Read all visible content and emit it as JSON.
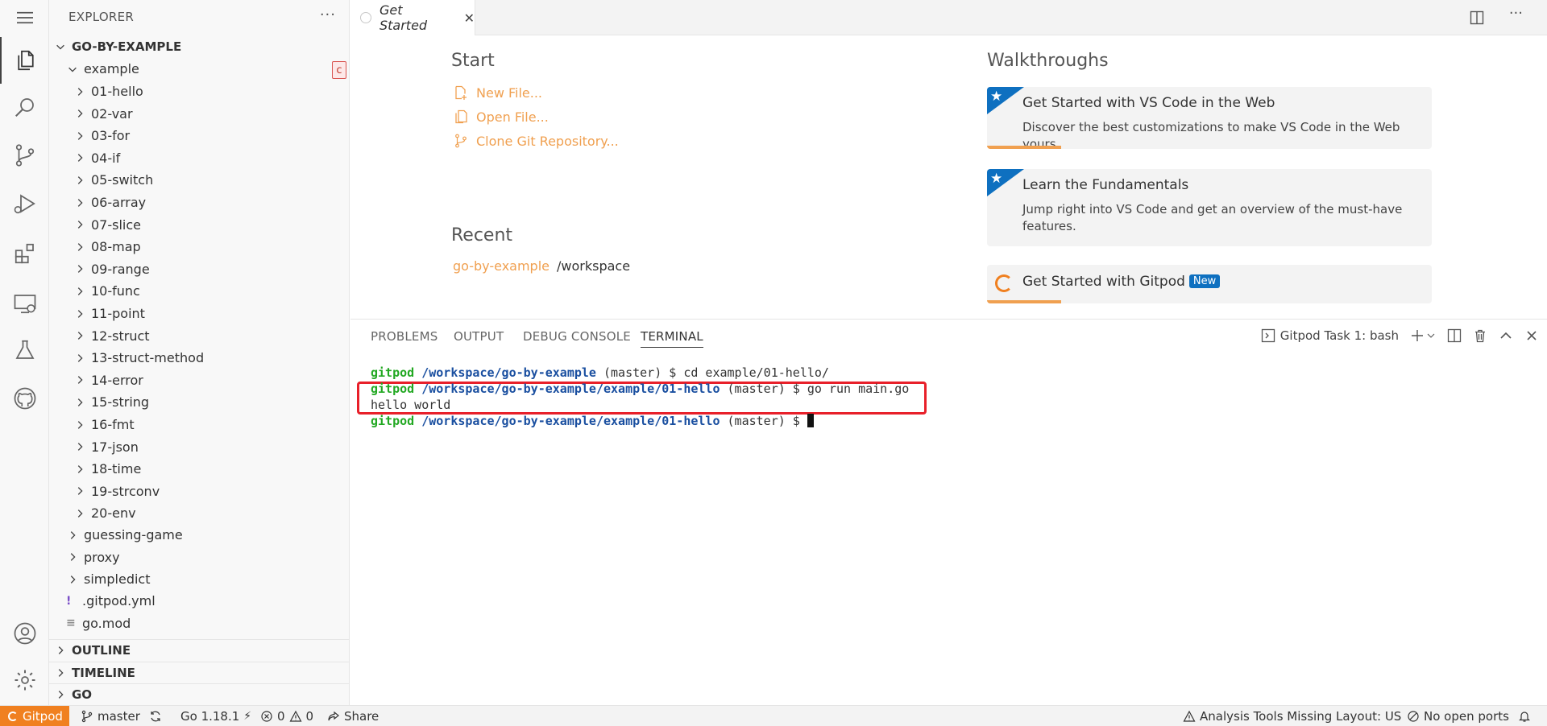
{
  "explorer": {
    "title": "EXPLORER",
    "more": "···",
    "root": "GO-BY-EXAMPLE",
    "folder": "example",
    "badge": "c",
    "subfolders": [
      "01-hello",
      "02-var",
      "03-for",
      "04-if",
      "05-switch",
      "06-array",
      "07-slice",
      "08-map",
      "09-range",
      "10-func",
      "11-point",
      "12-struct",
      "13-struct-method",
      "14-error",
      "15-string",
      "16-fmt",
      "17-json",
      "18-time",
      "19-strconv",
      "20-env"
    ],
    "top_items": [
      "guessing-game",
      "proxy",
      "simpledict"
    ],
    "files": [
      {
        "icon": "!",
        "name": ".gitpod.yml"
      },
      {
        "icon": "≡",
        "name": "go.mod"
      }
    ],
    "sections": [
      "OUTLINE",
      "TIMELINE",
      "GO"
    ]
  },
  "editor": {
    "tab_label": "Get Started",
    "tab_close": "✕"
  },
  "welcome": {
    "start_heading": "Start",
    "start_links": [
      "New File...",
      "Open File...",
      "Clone Git Repository..."
    ],
    "recent_heading": "Recent",
    "recent": {
      "name": "go-by-example",
      "path": "/workspace"
    },
    "walkthroughs_heading": "Walkthroughs",
    "cards": [
      {
        "title": "Get Started with VS Code in the Web",
        "desc": "Discover the best customizations to make VS Code in the Web yours."
      },
      {
        "title": "Learn the Fundamentals",
        "desc": "Jump right into VS Code and get an overview of the must-have features."
      },
      {
        "title": "Get Started with Gitpod",
        "badge": "New"
      }
    ]
  },
  "panel": {
    "tabs": [
      "PROBLEMS",
      "OUTPUT",
      "DEBUG CONSOLE",
      "TERMINAL"
    ],
    "active_tab": "TERMINAL",
    "terminal_name": "Gitpod Task 1: bash",
    "terminal_lines": [
      {
        "user": "gitpod",
        "path": "/workspace/go-by-example",
        "rest": " (master) $ cd example/01-hello/"
      },
      {
        "user": "gitpod",
        "path": "/workspace/go-by-example/example/01-hello",
        "rest": " (master) $ go run main.go"
      },
      {
        "output": "hello world"
      },
      {
        "user": "gitpod",
        "path": "/workspace/go-by-example/example/01-hello",
        "rest": " (master) $ "
      }
    ]
  },
  "status": {
    "gitpod": "Gitpod",
    "branch": "master",
    "go_version": "Go 1.18.1",
    "errors": "0",
    "warnings": "0",
    "share": "Share",
    "analysis": "Analysis Tools Missing",
    "layout": "Layout: US",
    "ports": "No open ports"
  },
  "colors": {
    "accent": "#f08020",
    "link": "#f0a050",
    "walkthrough_blue": "#0e70c0",
    "terminal_user": "#22a822",
    "terminal_path": "#1a4fa0",
    "highlight": "#e8202a"
  }
}
